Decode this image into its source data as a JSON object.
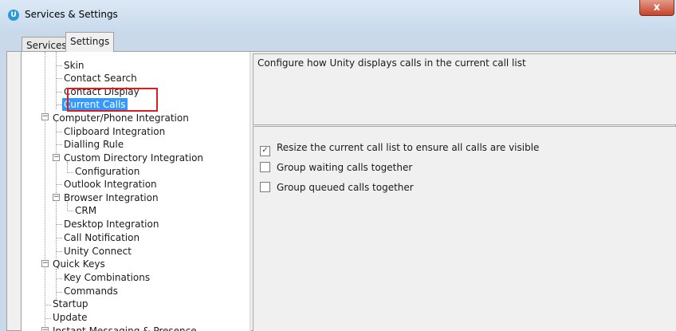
{
  "window": {
    "title": "Services & Settings",
    "app_icon": "unity-logo",
    "close_glyph": "x"
  },
  "tabs": [
    {
      "label": "Services"
    },
    {
      "label": "Settings",
      "active": true
    }
  ],
  "tree": {
    "items": [
      {
        "label": "Skin"
      },
      {
        "label": "Contact Search"
      },
      {
        "label": "Contact Display"
      },
      {
        "label": "Current Calls",
        "selected": true
      },
      {
        "label": "Computer/Phone Integration",
        "expanded": true
      },
      {
        "label": "Clipboard Integration"
      },
      {
        "label": "Dialling Rule"
      },
      {
        "label": "Custom Directory Integration",
        "expanded": true
      },
      {
        "label": "Configuration"
      },
      {
        "label": "Outlook Integration"
      },
      {
        "label": "Browser Integration",
        "expanded": true
      },
      {
        "label": "CRM"
      },
      {
        "label": "Desktop Integration"
      },
      {
        "label": "Call Notification"
      },
      {
        "label": "Unity Connect"
      },
      {
        "label": "Quick Keys",
        "expanded": true
      },
      {
        "label": "Key Combinations"
      },
      {
        "label": "Commands"
      },
      {
        "label": "Startup"
      },
      {
        "label": "Update"
      },
      {
        "label": "Instant Messaging & Presence",
        "expanded": true
      }
    ]
  },
  "description": "Configure how Unity displays calls in the current call list",
  "options": [
    {
      "label": "Resize the current call list to ensure all calls are visible",
      "checked": true
    },
    {
      "label": "Group waiting calls together",
      "checked": false
    },
    {
      "label": "Group queued calls together",
      "checked": false
    }
  ],
  "colors": {
    "selection": "#3399ff",
    "highlight": "#d81e1e"
  }
}
